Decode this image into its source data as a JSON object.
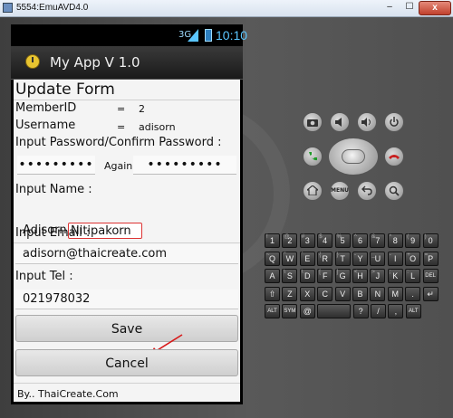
{
  "window": {
    "title": "5554:EmuAVD4.0",
    "min": "–",
    "max": "☐",
    "close": "x"
  },
  "status": {
    "network": "3G",
    "time": "10:10"
  },
  "app": {
    "title": "My App V 1.0"
  },
  "form": {
    "title": "Update Form",
    "member_label": "MemberID",
    "member_eq": "=",
    "member_value": "2",
    "username_label": "Username",
    "username_eq": "=",
    "username_value": "adisorn",
    "password_label": "Input Password/Confirm Password :",
    "password_mask": "•••••••••",
    "again_label": "Again",
    "confirm_mask": "•••••••••",
    "name_label": "Input Name :",
    "first_name": "Adisorn",
    "last_name": "Nitipakorn",
    "email_label": "Input Email :",
    "email_value": "adisorn@thaicreate.com",
    "tel_label": "Input Tel :",
    "tel_value": "021978032",
    "save_label": "Save",
    "cancel_label": "Cancel",
    "footer": "By.. ThaiCreate.Com"
  },
  "keyboard": {
    "rows": [
      [
        {
          "k": "1",
          "s": "!"
        },
        {
          "k": "2",
          "s": "@"
        },
        {
          "k": "3",
          "s": "#"
        },
        {
          "k": "4",
          "s": "$"
        },
        {
          "k": "5",
          "s": "%"
        },
        {
          "k": "6",
          "s": "^"
        },
        {
          "k": "7",
          "s": "&"
        },
        {
          "k": "8",
          "s": "*"
        },
        {
          "k": "9",
          "s": "("
        },
        {
          "k": "0",
          "s": ")"
        }
      ],
      [
        {
          "k": "Q",
          "s": "~"
        },
        {
          "k": "W",
          "s": "\""
        },
        {
          "k": "E",
          "s": "`"
        },
        {
          "k": "R",
          "s": "{"
        },
        {
          "k": "T",
          "s": "}"
        },
        {
          "k": "Y",
          "s": "-"
        },
        {
          "k": "U",
          "s": "_"
        },
        {
          "k": "I",
          "s": "-"
        },
        {
          "k": "O",
          "s": "+"
        },
        {
          "k": "P",
          "s": "="
        }
      ],
      [
        {
          "k": "A",
          "s": ""
        },
        {
          "k": "S",
          "s": "\\"
        },
        {
          "k": "D",
          "s": "\\"
        },
        {
          "k": "F",
          "s": "["
        },
        {
          "k": "G",
          "s": "]"
        },
        {
          "k": "H",
          "s": "<"
        },
        {
          "k": "J",
          "s": ">"
        },
        {
          "k": "K",
          "s": ";"
        },
        {
          "k": "L",
          "s": ":"
        },
        {
          "k": "DEL",
          "s": ""
        }
      ],
      [
        {
          "k": "⇧",
          "s": ""
        },
        {
          "k": "Z",
          "s": ""
        },
        {
          "k": "X",
          "s": ""
        },
        {
          "k": "C",
          "s": ""
        },
        {
          "k": "V",
          "s": ""
        },
        {
          "k": "B",
          "s": ""
        },
        {
          "k": "N",
          "s": ""
        },
        {
          "k": "M",
          "s": ""
        },
        {
          "k": ".",
          "s": ""
        },
        {
          "k": "↵",
          "s": ""
        }
      ],
      [
        {
          "k": "ALT",
          "s": ""
        },
        {
          "k": "SYM",
          "s": ""
        },
        {
          "k": "@",
          "s": ""
        },
        {
          "k": "",
          "s": ""
        },
        {
          "k": "?",
          "s": ""
        },
        {
          "k": "/",
          "s": ""
        },
        {
          "k": ",",
          "s": ""
        },
        {
          "k": "ALT",
          "s": ""
        }
      ]
    ]
  }
}
